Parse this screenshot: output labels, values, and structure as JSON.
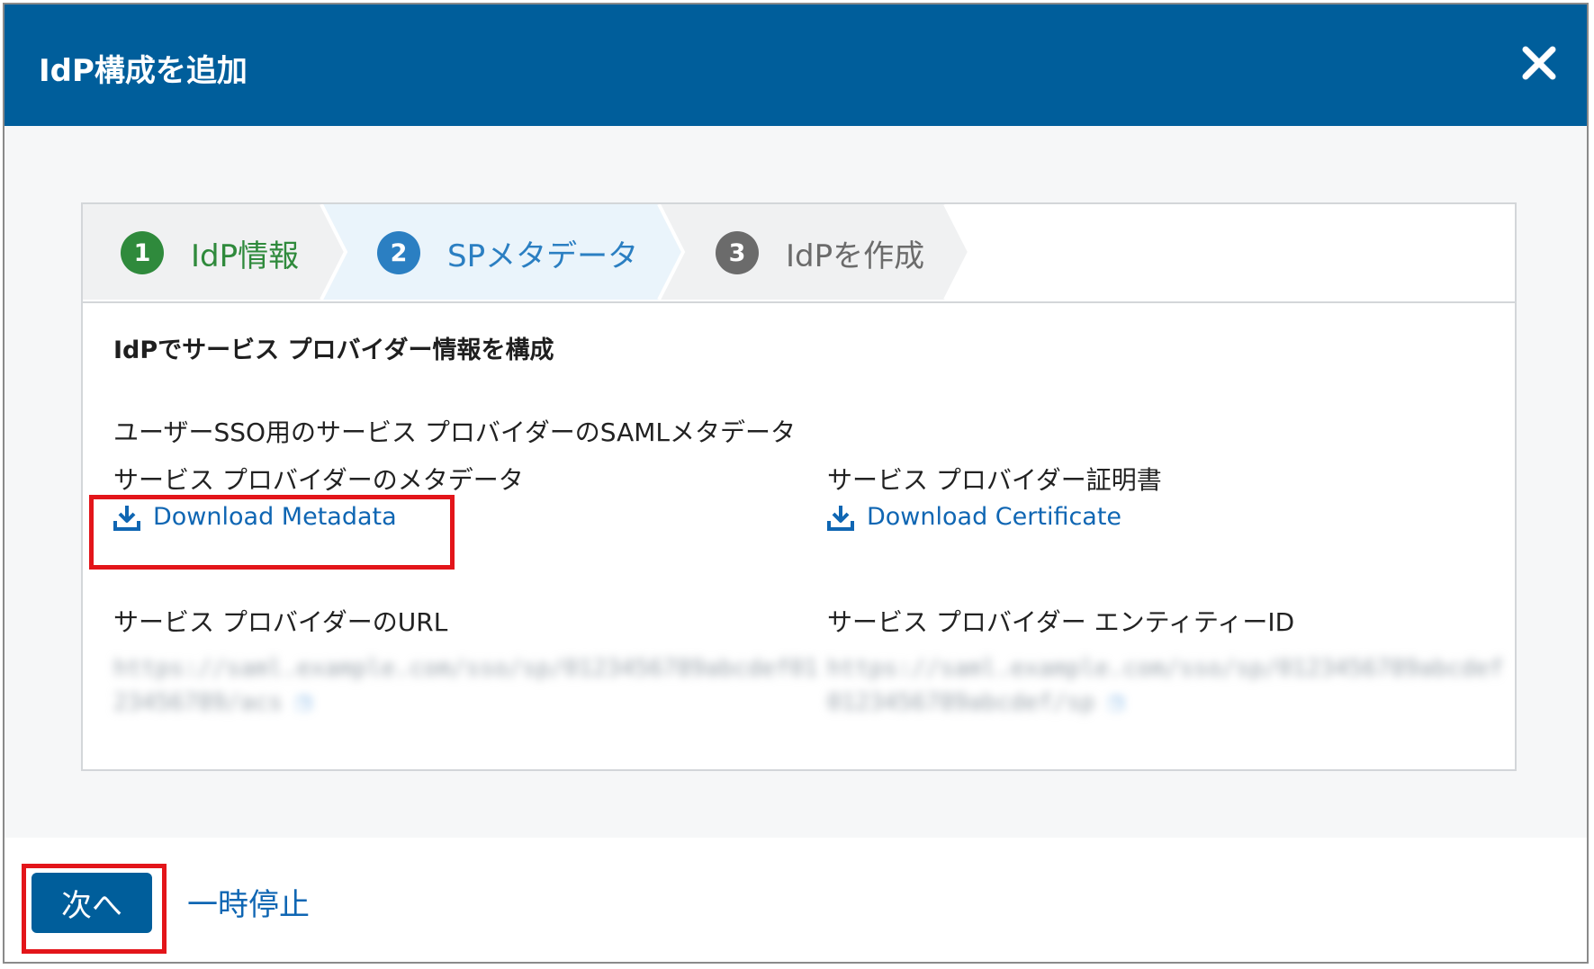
{
  "dialog": {
    "title": "IdP構成を追加",
    "close_icon": "close-icon"
  },
  "steps": [
    {
      "number": "1",
      "label": "IdP情報",
      "state": "completed",
      "color": "#2f8a3c"
    },
    {
      "number": "2",
      "label": "SPメタデータ",
      "state": "active",
      "color": "#2b7fc2"
    },
    {
      "number": "3",
      "label": "IdPを作成",
      "state": "upcoming",
      "color": "#6b6b6b"
    }
  ],
  "content": {
    "heading": "IdPでサービス プロバイダー情報を構成",
    "subheading": "ユーザーSSO用のサービス プロバイダーのSAMLメタデータ",
    "metadata_label": "サービス プロバイダーのメタデータ",
    "metadata_link": "Download Metadata",
    "certificate_label": "サービス プロバイダー証明書",
    "certificate_link": "Download Certificate",
    "url_label": "サービス プロバイダーのURL",
    "url_value_line1": "https://saml.example.com/sso/sp/0123456789abcdef01",
    "url_value_line2": "23456789/acs",
    "entity_label": "サービス プロバイダー エンティティーID",
    "entity_value_line1": "https://saml.example.com/sso/sp/0123456789abcdef",
    "entity_value_line2": "0123456789abcdef/sp",
    "copy_icon": "copy-icon"
  },
  "footer": {
    "next_label": "次へ",
    "pause_label": "一時停止"
  },
  "colors": {
    "header_bg": "#005e9b",
    "link": "#0f66b3",
    "highlight": "#e3151a"
  }
}
